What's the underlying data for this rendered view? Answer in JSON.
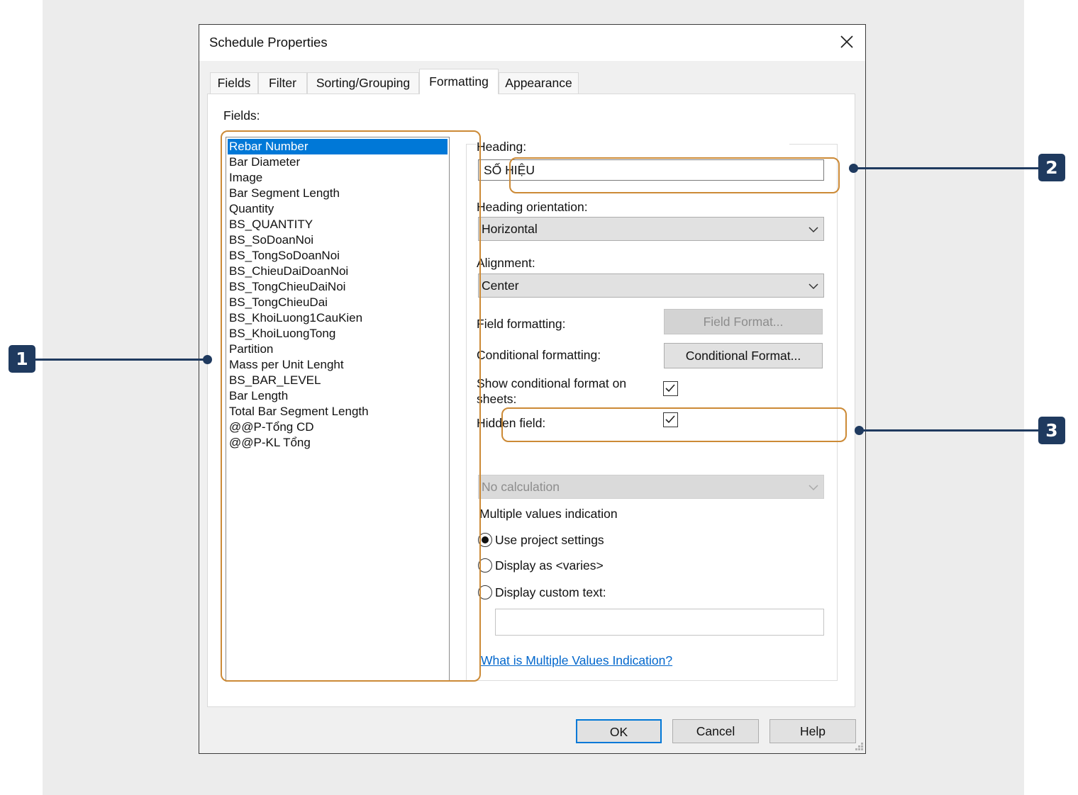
{
  "window": {
    "title": "Schedule Properties",
    "close_icon": "close-icon"
  },
  "tabs": [
    {
      "label": "Fields"
    },
    {
      "label": "Filter"
    },
    {
      "label": "Sorting/Grouping"
    },
    {
      "label": "Formatting",
      "active": true
    },
    {
      "label": "Appearance"
    }
  ],
  "fields": {
    "label": "Fields:",
    "selected": "Rebar Number",
    "items": [
      "Rebar Number",
      "Bar Diameter",
      "Image",
      "Bar Segment Length",
      "Quantity",
      "BS_QUANTITY",
      "BS_SoDoanNoi",
      "BS_TongSoDoanNoi",
      "BS_ChieuDaiDoanNoi",
      "BS_TongChieuDaiNoi",
      "BS_TongChieuDai",
      "BS_KhoiLuong1CauKien",
      "BS_KhoiLuongTong",
      "Partition",
      "Mass per Unit Lenght",
      "BS_BAR_LEVEL",
      "Bar Length",
      "Total Bar Segment Length",
      "@@P-Tổng CD",
      "@@P-KL Tổng"
    ]
  },
  "formatting": {
    "heading_label": "Heading:",
    "heading_value": "SỐ HIỆU",
    "orientation_label": "Heading orientation:",
    "orientation_value": "Horizontal",
    "alignment_label": "Alignment:",
    "alignment_value": "Center",
    "field_formatting_label": "Field formatting:",
    "field_format_button": "Field Format...",
    "conditional_formatting_label": "Conditional formatting:",
    "conditional_format_button": "Conditional Format...",
    "show_conditional_label": "Show conditional format on sheets:",
    "show_conditional_checked": true,
    "hidden_field_label": "Hidden field:",
    "hidden_field_checked": true,
    "calculation_value": "No calculation",
    "multiple_values_label": "Multiple values indication",
    "options": [
      "Use project settings",
      "Display as <varies>",
      "Display custom text:"
    ],
    "selected_option": "Use project settings",
    "custom_text_value": "",
    "help_link": "What is Multiple Values Indication?"
  },
  "buttons": {
    "ok": "OK",
    "cancel": "Cancel",
    "help": "Help"
  },
  "callouts": {
    "one": "1",
    "two": "2",
    "three": "3"
  },
  "colors": {
    "accent": "#0078d7",
    "highlight_box": "#cc8a36",
    "callout": "#1f3a5f",
    "link": "#0066cc"
  }
}
